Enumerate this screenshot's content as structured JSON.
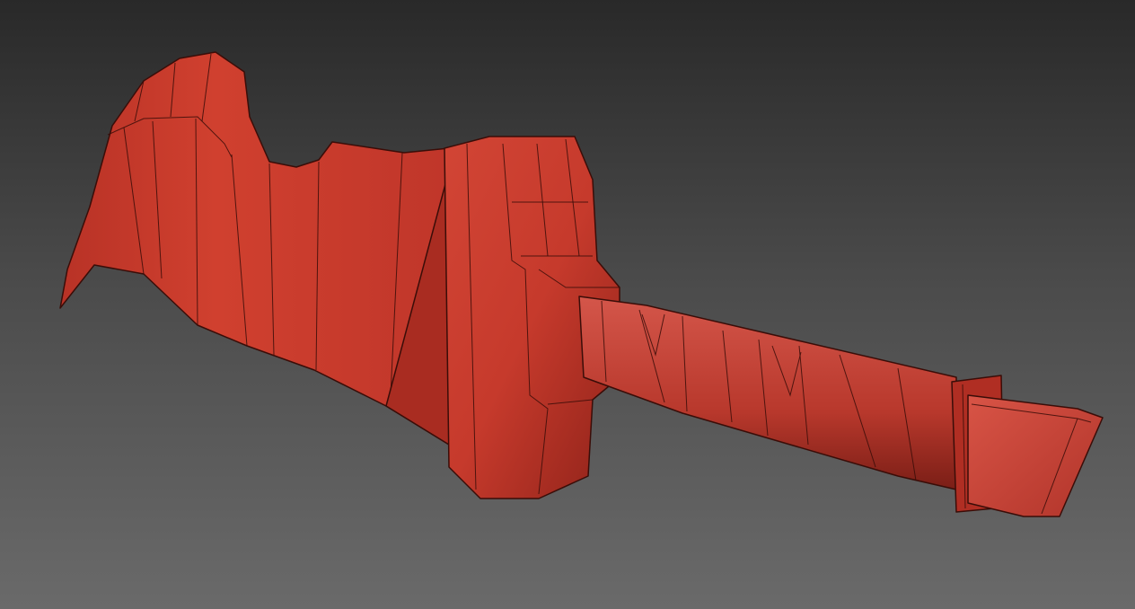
{
  "scene": {
    "background_top": "#292929",
    "background_bottom": "#6a6a6a",
    "model_color": "#c93a2c",
    "model_highlight": "#e06050",
    "model_shadow": "#8a2018",
    "edge_color": "#3a0d08"
  }
}
